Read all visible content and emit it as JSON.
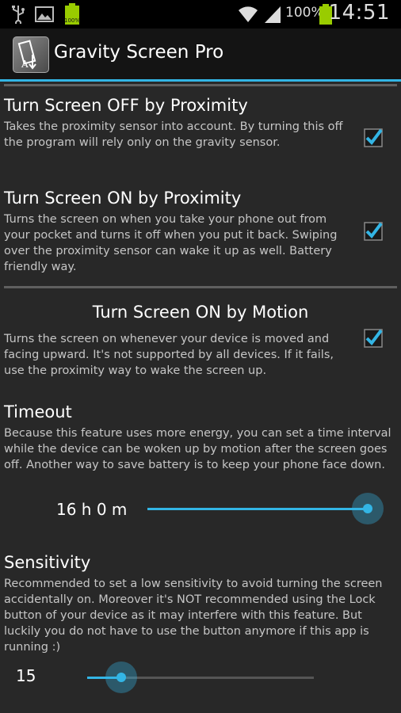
{
  "status_bar": {
    "battery_percent": "100%",
    "time": "14:51",
    "icons": [
      "usb-icon",
      "image-icon",
      "battery-icon",
      "wifi-icon",
      "signal-icon"
    ]
  },
  "app": {
    "title": "Gravity Screen Pro",
    "accent": "#33b5e5"
  },
  "prefs": [
    {
      "title": "Turn Screen OFF by Proximity",
      "summary": "Takes the proximity sensor into account. By turning this off the program will rely only on the gravity sensor.",
      "checked": true
    },
    {
      "title": "Turn Screen ON by Proximity",
      "summary": "Turns the screen on when you take your phone out from your pocket and turns it off when you put it back. Swiping over the proximity sensor can wake it up as well. Battery friendly way.",
      "checked": true
    }
  ],
  "motion": {
    "header": "Turn Screen ON by Motion",
    "summary": "Turns the screen on whenever your device is moved and facing upward. It's not supported by all devices. If it fails, use the proximity way to wake the screen up.",
    "checked": true
  },
  "timeout": {
    "title": "Timeout",
    "summary": "Because this feature uses more energy, you can set a time interval while the device can be woken up by motion after the screen goes off. Another way to save battery is to keep your phone face down.",
    "value_label": "16 h 0 m",
    "fraction": 1.0
  },
  "sensitivity": {
    "title": "Sensitivity",
    "summary": "Recommended to set a low sensitivity to avoid turning the screen accidentally on. Moreover it's NOT recommended using the Lock button of your device as it may interfere with this feature. But luckily you do not have to use the button anymore if this app is running :)",
    "value_label": "15",
    "fraction": 0.15
  }
}
